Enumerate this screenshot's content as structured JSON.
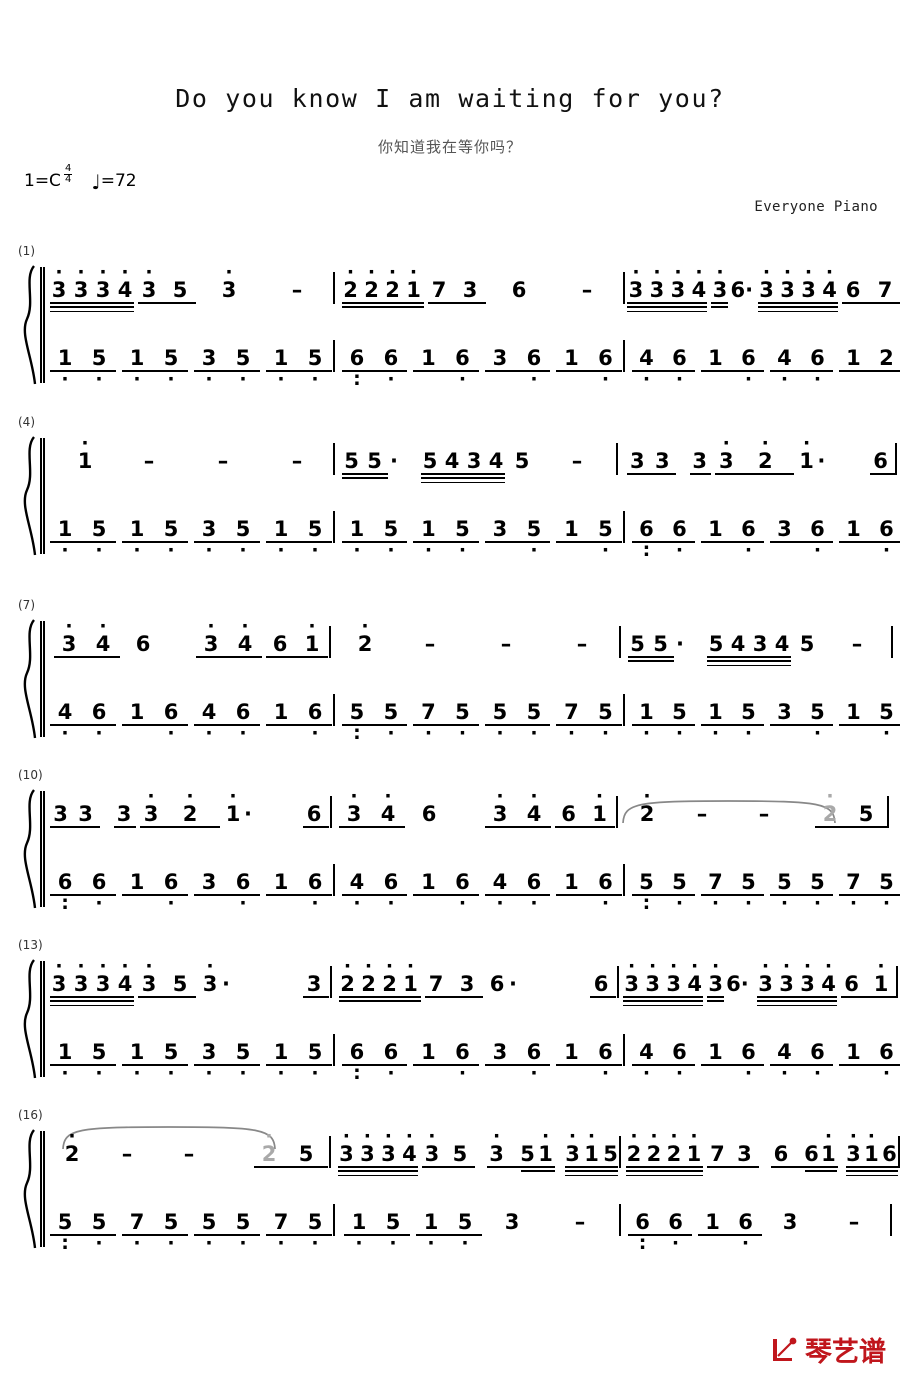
{
  "header": {
    "title": "Do you know I am waiting for you?",
    "subtitle": "你知道我在等你吗？",
    "key_label": "1=C",
    "time_num": "4",
    "time_den": "4",
    "tempo_note": "♩",
    "tempo_eq": "=72",
    "credit": "Everyone Piano"
  },
  "watermark": {
    "mark": "↖",
    "text": "琴艺谱",
    "color": "#c0161c"
  },
  "notation": {
    "clef_brace": "piano-brace",
    "systems": [
      {
        "number": "(1)"
      },
      {
        "number": "(4)"
      },
      {
        "number": "(7)"
      },
      {
        "number": "(10)"
      },
      {
        "number": "(13)"
      },
      {
        "number": "(16)"
      }
    ]
  },
  "chart_data": {
    "type": "table",
    "title": "Do you know I am waiting for you? — numbered musical notation (jianpu)",
    "key": "1=C",
    "time_signature": "4/4",
    "tempo_bpm": 72,
    "staves": [
      "melody",
      "accompaniment"
    ],
    "systems": [
      {
        "number": "(1)",
        "measures": [
          {
            "index": 1,
            "melody": "3'3'3'4' 3' 5 | 3' -",
            "accompaniment": "1. 5. 1. 5. 3. 5. 1. 5."
          },
          {
            "index": 2,
            "melody": "2'2'2'1' 7 3 | 6 -",
            "accompaniment": "6: 6. 1 6. 3 6. 1 6."
          },
          {
            "index": 3,
            "melody": "3'3'3'4' 3'6· | 3'3'3'4' 6 7",
            "accompaniment": "4. 6. 1 6. 4. 6. 1 2"
          }
        ]
      },
      {
        "number": "(4)",
        "measures": [
          {
            "index": 4,
            "melody": "1' - - -",
            "accompaniment": "1. 5. 1. 5. 3. 5. 1. 5."
          },
          {
            "index": 5,
            "melody": "5 5· 5 4 3 4 5 -",
            "accompaniment": "1. 5. 1. 5. 3 5. 1 5."
          },
          {
            "index": 6,
            "melody": "3 3 3 3' 2' 1'· 6",
            "accompaniment": "6: 6. 1 6. 3 6. 1 6."
          }
        ]
      },
      {
        "number": "(7)",
        "measures": [
          {
            "index": 7,
            "melody": "3' 4' 6 3' 4' 6 1'",
            "accompaniment": "4. 6. 1 6. 4. 6. 1 6."
          },
          {
            "index": 8,
            "melody": "2' - - -",
            "accompaniment": "5: 5. 7. 5. 5. 5. 7. 5."
          },
          {
            "index": 9,
            "melody": "5 5· 5 4 3 4 5 -",
            "accompaniment": "1. 5. 1. 5. 3 5. 1 5."
          }
        ]
      },
      {
        "number": "(10)",
        "measures": [
          {
            "index": 10,
            "melody": "3 3 3 3' 2' 1'· 6",
            "accompaniment": "6: 6. 1 6. 3 6. 1 6."
          },
          {
            "index": 11,
            "melody": "3' 4' 6 3' 4' 6 1'",
            "accompaniment": "4. 6. 1 6. 4. 6. 1 6."
          },
          {
            "index": 12,
            "melody": "2' - - 2' 5  (tied 2')",
            "accompaniment": "5: 5. 7. 5. 5. 5. 7. 5."
          }
        ]
      },
      {
        "number": "(13)",
        "measures": [
          {
            "index": 13,
            "melody": "3'3'3'4' 3' 5 | 3'· 3",
            "accompaniment": "1. 5. 1. 5. 3. 5. 1. 5."
          },
          {
            "index": 14,
            "melody": "2'2'2'1' 7 3 | 6· 6",
            "accompaniment": "6: 6. 1 6. 3 6. 1 6."
          },
          {
            "index": 15,
            "melody": "3'3'3'4' 3'6· | 3'3'3'4' 6 1'",
            "accompaniment": "4. 6. 1 6. 4. 6. 1 6."
          }
        ]
      },
      {
        "number": "(16)",
        "measures": [
          {
            "index": 16,
            "melody": "2' - - 2' 5  (tied 2')",
            "accompaniment": "5: 5. 7. 5. 5. 5. 7. 5."
          },
          {
            "index": 17,
            "melody": "3'3'3'4' 3' 5 | 3' 5 1' 3' 1' 5",
            "accompaniment": "1. 5. 1. 5. 3 -"
          },
          {
            "index": 18,
            "melody": "2'2'2'1' 7 3 | 6 6 1' 3' 1' 6",
            "accompaniment": "6: 6. 1 6. 3 -"
          }
        ]
      }
    ]
  }
}
